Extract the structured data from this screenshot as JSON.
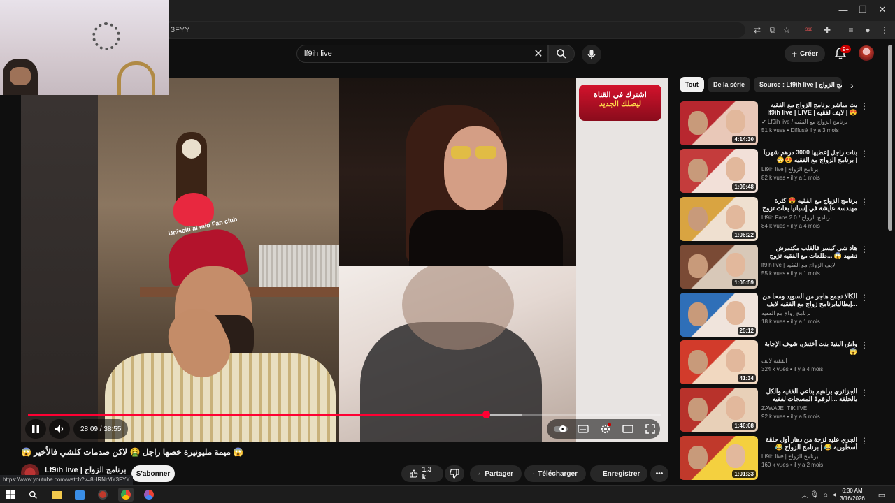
{
  "browser": {
    "url_fragment": "3FYY",
    "window_controls": [
      "minimize-icon",
      "restore-icon",
      "close-icon"
    ],
    "ext_badge": "318"
  },
  "search": {
    "query": "lf9ih live"
  },
  "header": {
    "create_label": "Créer",
    "notif_badge": "9+"
  },
  "video": {
    "time": "28:09 / 38:55",
    "progress": 0.7232,
    "buffered": 0.78,
    "overlay_text_line1": "اشترك في القناة",
    "overlay_text_line2": "ليصلك الجديد",
    "filter_text": "Unisciti al mio Fan club",
    "colors": {
      "progress": "#ff0033"
    }
  },
  "info": {
    "title": "😱 ميمة مليونيرة خصها راجل 🤮 لاكن صدمات كلشي فالأخير 😱",
    "channel": "Lf9ih live | برنامج الزواج",
    "subscribe": "S'abonner",
    "likes": "1,3 k",
    "share": "Partager",
    "download": "Télécharger",
    "save": "Enregistrer",
    "status_url": "https://www.youtube.com/watch?v=8HRNrMY3FYY"
  },
  "chips": [
    "Tout",
    "De la série",
    "Source : Lf9ih live | برنامج الزواج"
  ],
  "recs": [
    {
      "title": "بث مباشر برنامج الزواج مع الفقيه 😍 | لايف لفقيه | lf9ih live | LIVE lf9ih",
      "channel": "✔ Lf9ih live / برنامج الزواج مع الفقيه",
      "meta": "51 k vues • Diffusé il y a 3 mois",
      "duration": "4:14:30"
    },
    {
      "title": "بنات راجل إعطيها 3000 درهم شهرياً | برنامج الزواج مع الفقيه 😍😳",
      "channel": "Lf9ih live | برنامج الزواج",
      "meta": "82 k vues • il y a 1 mois",
      "duration": "1:09:48"
    },
    {
      "title": "برنامج الزواج مع الفقيه 😍 كثرة مهندسة عايشة في إسبانيا بغات تزوج 😍",
      "channel": "Lf9ih Fans 2.0 / برنامج الزواج",
      "meta": "84 k vues • il y a 4 mois",
      "duration": "1:06:22"
    },
    {
      "title": "هاد شي كيسر فالقلب مكتمرش تشهد 😱 ...طلعات مع الفقيه تزوج وكانت صدمة",
      "channel": "lf9ih live | لايف الزواج مع الفقيه",
      "meta": "55 k vues • il y a 1 mois",
      "duration": "1:05:59"
    },
    {
      "title": "الكالا تجمع هاجر من السويد ومحا من ...إيطاليابرنامج زواج مع الفقيه لايف",
      "channel": "برنامج زواج مع الفقيه",
      "meta": "18 k vues • il y a 1 mois",
      "duration": "25:12"
    },
    {
      "title": "واش البنية بنت أختش، شوف الإجابة 😱",
      "channel": "الفقيه لايف",
      "meta": "324 k vues • il y a 4 mois",
      "duration": "41:34"
    },
    {
      "title": "الجزائري براهيم بتاعي الفقيه والكل بالحلقة ...الرقم1 المسجات لفقيه لكحصق عليك",
      "channel": "ZAWAJE_TIK liVE",
      "meta": "92 k vues • il y a 5 mois",
      "duration": "1:46:08"
    },
    {
      "title": "الجري عليه لزجة من دهار أول حلقة أسطورية 😂 | برنامج الزواج 😂",
      "channel": "Lf9ih live | برنامج الزواج",
      "meta": "160 k vues • il y a 2 mois",
      "duration": "1:01:33"
    }
  ],
  "taskbar": {
    "time": "6:30 AM",
    "date": "3/16/2026"
  }
}
